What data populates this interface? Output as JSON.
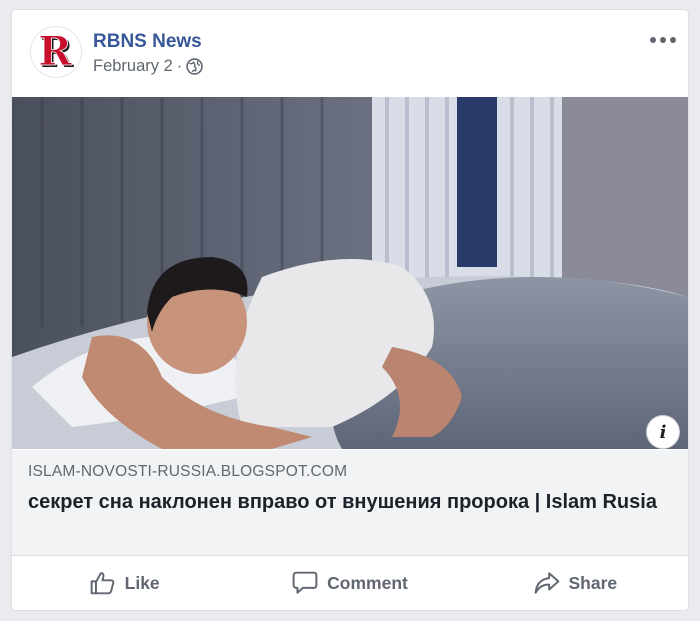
{
  "post": {
    "page_name": "RBNS News",
    "date": "February 2",
    "separator": "·",
    "privacy_icon": "globe-icon",
    "more_icon": "more-options-icon",
    "avatar_letter": "R"
  },
  "link_preview": {
    "domain": "ISLAM-NOVOSTI-RUSSIA.BLOGSPOT.COM",
    "title": "секрет сна наклонен вправо от внушения пророка | Islam Rusia",
    "info_icon_label": "i"
  },
  "actions": [
    {
      "label": "Like",
      "icon": "thumbs-up-icon"
    },
    {
      "label": "Comment",
      "icon": "comment-icon"
    },
    {
      "label": "Share",
      "icon": "share-icon"
    }
  ],
  "colors": {
    "page_name": "#385898",
    "meta_text": "#606770",
    "link_bg": "#f2f3f5",
    "avatar_red": "#c8102e"
  }
}
